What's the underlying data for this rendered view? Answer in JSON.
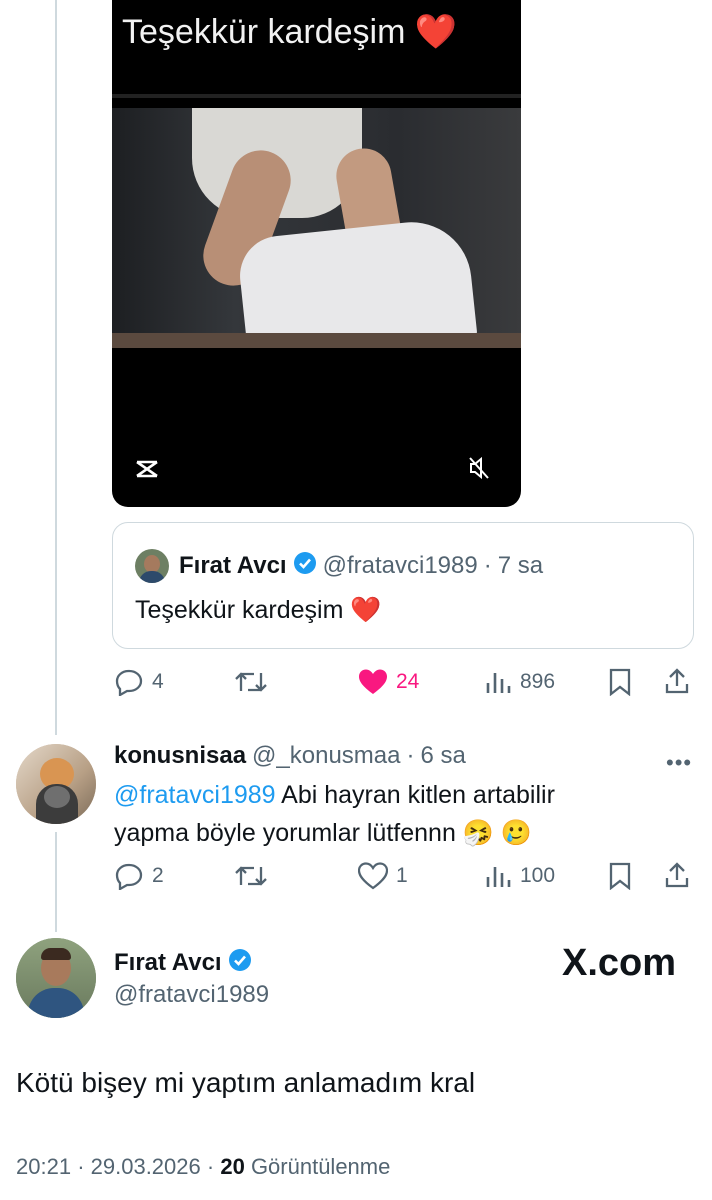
{
  "video": {
    "caption": "Teşekkür kardeşim",
    "caption_emoji": "❤️",
    "icons": [
      "capcut-icon",
      "mute-icon"
    ]
  },
  "quoted_tweet": {
    "author_name": "Fırat Avcı",
    "author_handle": "@fratavci1989",
    "time": "7 sa",
    "text": "Teşekkür kardeşim",
    "text_emoji": "❤️"
  },
  "tweet_actions": {
    "replies": "4",
    "retweets": "",
    "likes": "24",
    "views": "896",
    "liked": true
  },
  "reply": {
    "author_name": "konusnisaa",
    "author_handle": "@_konusmaa",
    "time": "6 sa",
    "mention": "@fratavci1989",
    "text_line1": "Abi hayran kitlen artabilir",
    "text_line2": "yapma böyle yorumlar lütfennn",
    "emojis": "🤧 🥲",
    "actions": {
      "replies": "2",
      "retweets": "",
      "likes": "1",
      "views": "100"
    }
  },
  "main_tweet": {
    "author_name": "Fırat Avcı",
    "author_handle": "@fratavci1989",
    "brand": "X.com",
    "text": "Kötü bişey mi yaptım anlamadım kral",
    "time": "20:21",
    "date": "29.03.2026",
    "views_count": "20",
    "views_label": "Görüntülenme"
  },
  "colors": {
    "accent": "#1d9bf0",
    "like": "#f91880",
    "muted": "#536471",
    "border": "#cfd9de"
  }
}
